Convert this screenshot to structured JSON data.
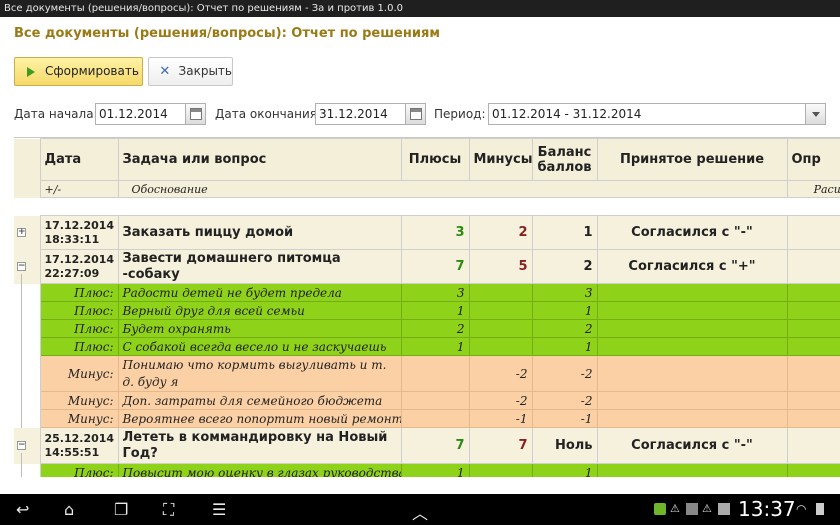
{
  "window": {
    "title": "Все документы (решения/вопросы): Отчет по решениям - За и против 1.0.0"
  },
  "page": {
    "title": "Все документы (решения/вопросы): Отчет по решениям"
  },
  "toolbar": {
    "generate_label": "Сформировать",
    "close_label": "Закрыть"
  },
  "filters": {
    "start_label": "Дата начала:",
    "start_value": "01.12.2014",
    "end_label": "Дата окончания:",
    "end_value": "31.12.2014",
    "period_label": "Период:",
    "period_value": "01.12.2014 - 31.12.2014"
  },
  "table": {
    "headers": [
      "Дата",
      "Задача или вопрос",
      "Плюсы",
      "Минусы",
      "Баланс баллов",
      "Принятое решение",
      "Опр"
    ],
    "subheaders": [
      "+/-",
      "Обоснование",
      "Расшифро"
    ],
    "groups": [
      {
        "date": "17.12.2014",
        "time": "18:33:11",
        "task": "Заказать пиццу домой",
        "plus": "3",
        "minus": "2",
        "balance": "1",
        "decision": "Согласился с \"-\"",
        "expanded": false
      },
      {
        "date": "17.12.2014",
        "time": "22:27:09",
        "task": "Завести домашнего питомца -собаку",
        "plus": "7",
        "minus": "5",
        "balance": "2",
        "decision": "Согласился с \"+\"",
        "expanded": true,
        "rows": [
          {
            "kind": "plus",
            "sign": "Плюс:",
            "text": "Радости детей не будет предела",
            "plus": "3",
            "minus": "",
            "balance": "3"
          },
          {
            "kind": "plus",
            "sign": "Плюс:",
            "text": "Верный друг для всей семьи",
            "plus": "1",
            "minus": "",
            "balance": "1"
          },
          {
            "kind": "plus",
            "sign": "Плюс:",
            "text": "Будет охранять",
            "plus": "2",
            "minus": "",
            "balance": "2"
          },
          {
            "kind": "plus",
            "sign": "Плюс:",
            "text": "С собакой всегда весело и не заскучаешь",
            "plus": "1",
            "minus": "",
            "balance": "1"
          },
          {
            "kind": "minus",
            "sign": "Минус:",
            "text": "Понимаю что кормить выгуливать и т. д. буду я",
            "plus": "",
            "minus": "-2",
            "balance": "-2"
          },
          {
            "kind": "minus",
            "sign": "Минус:",
            "text": "Доп. затраты для семейного бюджета",
            "plus": "",
            "minus": "-2",
            "balance": "-2"
          },
          {
            "kind": "minus",
            "sign": "Минус:",
            "text": "Вероятнее всего попортит новый ремонт",
            "plus": "",
            "minus": "-1",
            "balance": "-1"
          }
        ]
      },
      {
        "date": "25.12.2014",
        "time": "14:55:51",
        "task": "Лететь в коммандировку на Новый Год?",
        "plus": "7",
        "minus": "7",
        "balance": "Ноль",
        "decision": "Согласился с \"-\"",
        "expanded": true,
        "rows": [
          {
            "kind": "plus",
            "sign": "Плюс:",
            "text": "Повысит мою оценку в глазах руководства",
            "plus": "1",
            "minus": "",
            "balance": "1"
          }
        ]
      }
    ]
  },
  "statusbar": {
    "clock": "13:37"
  },
  "colors": {
    "accent": "#9b7a16",
    "plus_row": "#8fd21a",
    "minus_row": "#fbd0a4",
    "header": "#f4efd9"
  }
}
